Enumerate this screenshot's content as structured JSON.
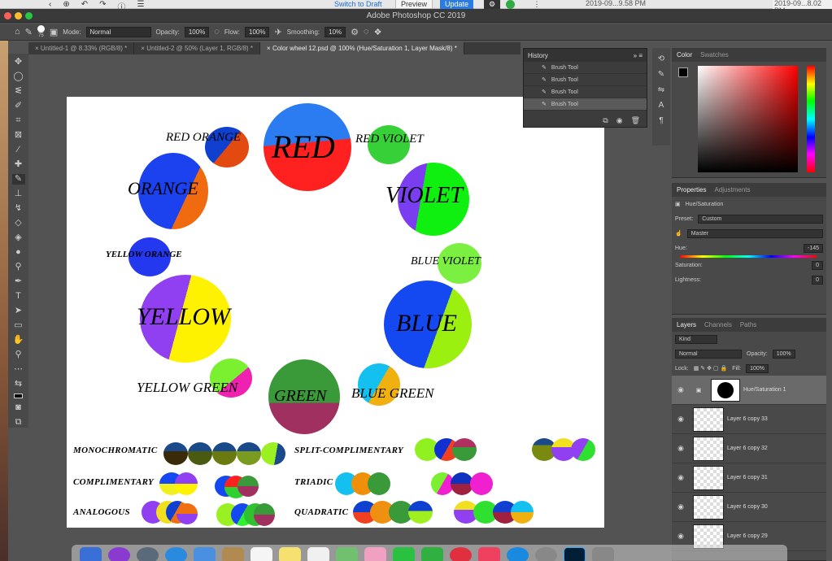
{
  "macbar": {
    "switch_label": "Switch to Draft",
    "preview_label": "Preview",
    "update_label": "Update",
    "right_date1": "2019-09...9.58 PM",
    "right_date2": "2019-09...8.02 PM"
  },
  "app": {
    "title": "Adobe Photoshop CC 2019"
  },
  "options": {
    "brush_size": "75",
    "mode_label": "Mode:",
    "mode": "Normal",
    "opacity_label": "Opacity:",
    "opacity": "100%",
    "flow_label": "Flow:",
    "flow": "100%",
    "smoothing_label": "Smoothing:",
    "smoothing": "10%"
  },
  "tabs": [
    "Untitled-1 @ 8.33% (RGB/8) *",
    "Untitled-2 @ 50% (Layer 1, RGB/8) *",
    "Color wheel 12.psd @ 100% (Hue/Saturation 1, Layer Mask/8) *"
  ],
  "canvas": {
    "labels": {
      "red": "RED",
      "red_orange": "RED ORANGE",
      "red_violet": "RED VIOLET",
      "orange": "ORANGE",
      "violet": "VIOLET",
      "yellow_orange": "YELLOW ORANGE",
      "blue_violet": "BLUE VIOLET",
      "yellow": "YELLOW",
      "blue": "BLUE",
      "yellow_green": "YELLOW GREEN",
      "green": "GREEN",
      "blue_green": "BLUE GREEN"
    },
    "schemes": {
      "monochromatic": "MONOCHROMATIC",
      "split_complimentary": "SPLIT-COMPLIMENTARY",
      "complimentary": "COMPLIMENTARY",
      "triadic": "TRIADIC",
      "analogous": "ANALOGOUS",
      "quadratic": "QUADRATIC"
    }
  },
  "history": {
    "title": "History",
    "items": [
      "Brush Tool",
      "Brush Tool",
      "Brush Tool",
      "Brush Tool"
    ]
  },
  "color_panel": {
    "tab1": "Color",
    "tab2": "Swatches"
  },
  "properties": {
    "tab1": "Properties",
    "tab2": "Adjustments",
    "heading": "Hue/Saturation",
    "preset_label": "Preset:",
    "preset": "Custom",
    "channel": "Master",
    "hue_label": "Hue:",
    "hue": "-145",
    "saturation_label": "Saturation:",
    "saturation": "0",
    "lightness_label": "Lightness:",
    "lightness": "0"
  },
  "layers": {
    "tab1": "Layers",
    "tab2": "Channels",
    "tab3": "Paths",
    "kind": "Kind",
    "blend": "Normal",
    "opacity_label": "Opacity:",
    "opacity": "100%",
    "lock_label": "Lock:",
    "fill_label": "Fill:",
    "fill": "100%",
    "items": [
      "Hue/Saturation 1",
      "Layer 6 copy 33",
      "Layer 6 copy 32",
      "Layer 6 copy 31",
      "Layer 6 copy 30",
      "Layer 6 copy 29"
    ]
  },
  "colors": {
    "accent": "#2a7be4",
    "panel": "#494949",
    "canvas_bg": "#535353"
  }
}
